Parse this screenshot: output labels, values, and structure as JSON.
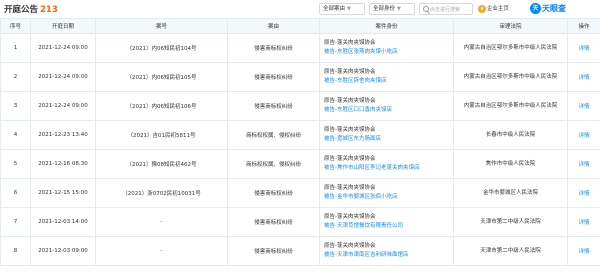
{
  "header": {
    "title": "开庭公告",
    "count": "213",
    "filter_year": "全部案由",
    "filter_role": "全部身份",
    "search_placeholder": "点击进行搜索",
    "pro_label": "企业主页",
    "logo_text": "天眼查"
  },
  "table": {
    "columns": [
      "序号",
      "开庭日期",
      "案号",
      "案由",
      "案件身份",
      "审理法院",
      "操作"
    ],
    "rows": [
      {
        "no": "1",
        "date": "2021-12-24 09:00",
        "case_no": "（2021）内06知民初104号",
        "cause": "侵害商标权纠纷",
        "plaintiff": "原告-蓬关肉夹馍协会",
        "defendant": "被告-东胜区张燕肉夹馍小吃店",
        "court": "内蒙古自治区鄂尔多斯市中级人民法院",
        "action": "详情"
      },
      {
        "no": "2",
        "date": "2021-12-24 09:00",
        "case_no": "（2021）内06知民初105号",
        "cause": "侵害商标权纠纷",
        "plaintiff": "原告-蓬关肉夹馍协会",
        "defendant": "被告-东胜区辞舍肉夹馍店",
        "court": "内蒙古自治区鄂尔多斯市中级人民法院",
        "action": "详情"
      },
      {
        "no": "3",
        "date": "2021-12-24 09:00",
        "case_no": "（2021）内06知民初106号",
        "cause": "侵害商标权纠纷",
        "plaintiff": "原告-蓬关肉夹馍协会",
        "defendant": "被告-东胜区口口香肉夹馍店",
        "court": "内蒙古自治区鄂尔多斯市中级人民法院",
        "action": "详情"
      },
      {
        "no": "4",
        "date": "2021-12-23 13:40",
        "case_no": "（2021）吉01民初5811号",
        "cause": "商标权权属、侵权纠纷",
        "plaintiff": "原告-蓬关肉夹馍协会",
        "defendant": "被告-宽城区东方肠面店",
        "court": "长春市中级人民法院",
        "action": "详情"
      },
      {
        "no": "5",
        "date": "2021-12-16 08:30",
        "case_no": "（2021）豫08知民初462号",
        "cause": "商标权权属、侵权纠纷",
        "plaintiff": "原告-蓬关肉夹馍协会",
        "defendant": "被告-焦作市山阳区李记老蓬关肉夹馍店",
        "court": "焦作市中级人民法院",
        "action": "详情"
      },
      {
        "no": "6",
        "date": "2021-12-15 15:00",
        "case_no": "（2021）浙0702民初10031号",
        "cause": "侵害商标权纠纷",
        "plaintiff": "原告-蓬关肉夹馍协会",
        "defendant": "被告-金华市婺城区张佰小吃店",
        "court": "金华市婺城区人民法院",
        "action": "详情"
      },
      {
        "no": "7",
        "date": "2021-12-03 14:00",
        "case_no": "-",
        "cause": "侵害商标权纠纷",
        "plaintiff": "原告-蓬关肉夹馍协会",
        "defendant": "被告-天津苋馆餐饮有限责任公司",
        "court": "天津市第二中级人民法院",
        "action": "详情"
      },
      {
        "no": "8",
        "date": "2021-12-03 09:00",
        "case_no": "-",
        "cause": "侵害商标权纠纷",
        "plaintiff": "原告-蓬关肉夹馍协会",
        "defendant": "被告-天津市津南区吉利研味面馆店",
        "court": "天津市第二中级人民法院",
        "action": "详情"
      }
    ]
  }
}
